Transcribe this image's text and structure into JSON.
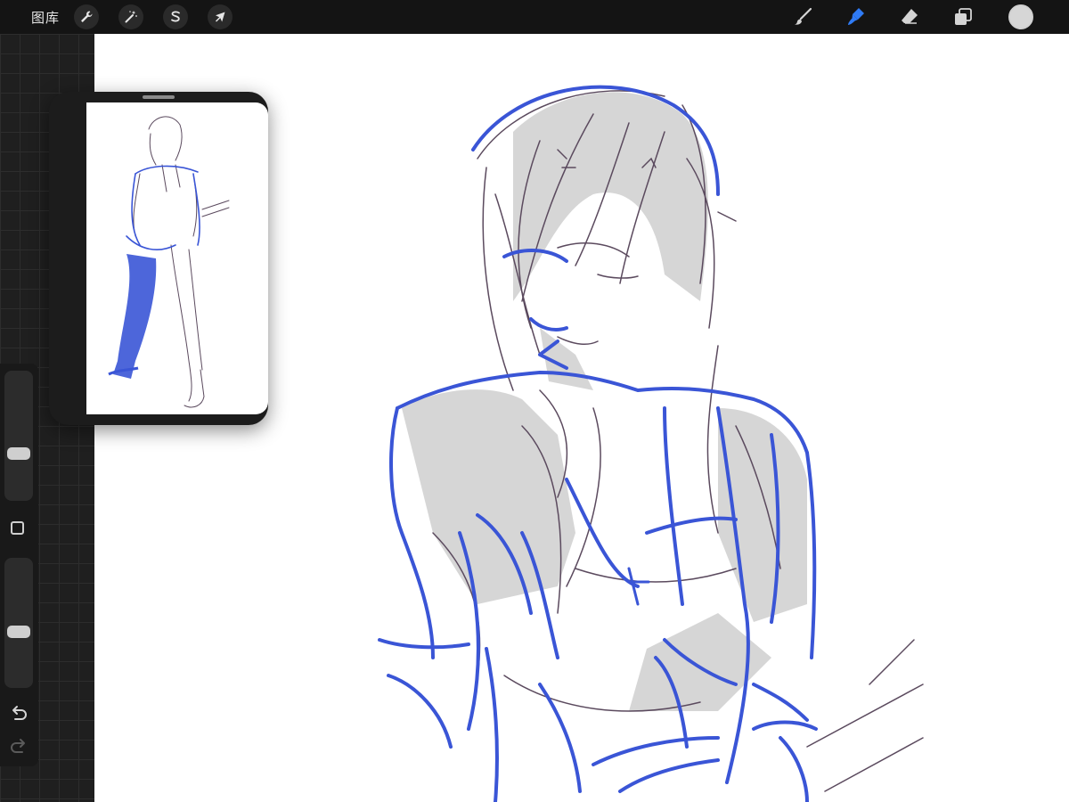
{
  "topbar": {
    "gallery_label": "图库",
    "left_tools": [
      {
        "name": "actions",
        "icon": "wrench-icon"
      },
      {
        "name": "adjustments",
        "icon": "magic-wand-icon"
      },
      {
        "name": "selection",
        "icon": "selection-s-icon"
      },
      {
        "name": "transform",
        "icon": "arrow-cursor-icon"
      }
    ],
    "right_tools": [
      {
        "name": "brush",
        "icon": "brush-icon",
        "active": false
      },
      {
        "name": "smudge",
        "icon": "smudge-icon",
        "active": true
      },
      {
        "name": "eraser",
        "icon": "eraser-icon",
        "active": false
      },
      {
        "name": "layers",
        "icon": "layers-icon",
        "active": false
      }
    ],
    "current_color": "#d6d6d6"
  },
  "colors": {
    "accent": "#2f7bf5",
    "stroke_blue": "#3a55d6",
    "stroke_dark": "#5b4a5e",
    "shade_gray": "#c8c8c8"
  },
  "sidebar": {
    "brush_size_level": 0.66,
    "opacity_level": 0.58
  }
}
